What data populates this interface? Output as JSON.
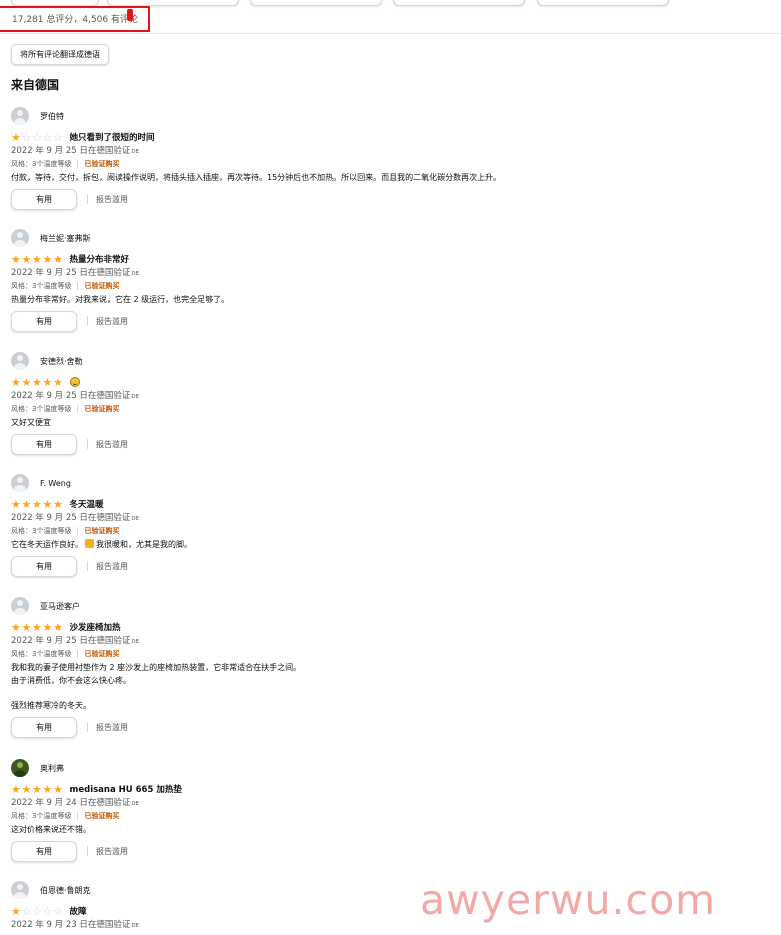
{
  "summary": {
    "total_text": "17,281 总评分，4,506 有评论"
  },
  "translate_button": "将所有评论翻译成德语",
  "section_title": "来自德国",
  "reviews": [
    {
      "author": "罗伯特",
      "rating": 1,
      "title": "她只看到了很短的时间",
      "date": "2022 年 9 月 25 日在德国验证",
      "date_suffix": "DE",
      "style": "风格：3个温度等级",
      "verified": "已验证购买",
      "body": [
        "付款，等待，交付，拆包，阅读操作说明，将插头插入插座，再次等待。15分钟后也不加热。所以回来。而且我的二氧化碳分数再次上升。"
      ],
      "helpful": "有用",
      "report": "报告滥用"
    },
    {
      "author": "梅兰妮·塞弗斯",
      "rating": 5,
      "title": "热量分布非常好",
      "date": "2022 年 9 月 25 日在德国验证",
      "date_suffix": "DE",
      "style": "风格：3个温度等级",
      "verified": "已验证购买",
      "body": [
        "热量分布非常好。对我来说，它在 2 级运行，也完全足够了。"
      ],
      "helpful": "有用",
      "report": "报告滥用"
    },
    {
      "author": "安德烈·舍勒",
      "rating": 5,
      "title": "",
      "title_icon": "grinning-face-icon",
      "date": "2022 年 9 月 25 日在德国验证",
      "date_suffix": "DE",
      "style": "风格：3个温度等级",
      "verified": "已验证购买",
      "body": [
        "又好又便宜"
      ],
      "helpful": "有用",
      "report": "报告滥用"
    },
    {
      "author": "F. Weng",
      "rating": 5,
      "title": "冬天温暖",
      "date": "2022 年 9 月 25 日在德国验证",
      "date_suffix": "DE",
      "style": "风格：3个温度等级",
      "verified": "已验证购买",
      "body_pre": "它在冬天运作良好。",
      "body_post": "我很暖和，尤其是我的脚。",
      "body_icon": "thumbs-up-icon",
      "helpful": "有用",
      "report": "报告滥用"
    },
    {
      "author": "亚马逊客户",
      "rating": 5,
      "title": "沙发座椅加热",
      "date": "2022 年 9 月 25 日在德国验证",
      "date_suffix": "DE",
      "style": "风格：3个温度等级",
      "verified": "已验证购买",
      "body": [
        "我和我的妻子使用衬垫作为 2 座沙发上的座椅加热装置，它非常适合在扶手之间。",
        "由于消费低，你不会这么快心疼。",
        "",
        "强烈推荐寒冷的冬天。"
      ],
      "helpful": "有用",
      "report": "报告滥用"
    },
    {
      "author": "奥利弗",
      "rating": 5,
      "title": "medisana HU 665 加热垫",
      "date": "2022 年 9 月 24 日在德国验证",
      "date_suffix": "DE",
      "style": "风格：3个温度等级",
      "verified": "已验证购买",
      "body": [
        "这对价格来说还不错。"
      ],
      "helpful": "有用",
      "report": "报告滥用"
    },
    {
      "author": "伯恩德·鲁朗克",
      "rating": 1,
      "title": "故障",
      "date": "2022 年 9 月 23 日在德国验证",
      "date_suffix": "DE"
    }
  ],
  "watermark": "awyerwu.com",
  "colors": {
    "star": "#ffa41c",
    "verified": "#c45500",
    "highlight": "#e3151a"
  }
}
